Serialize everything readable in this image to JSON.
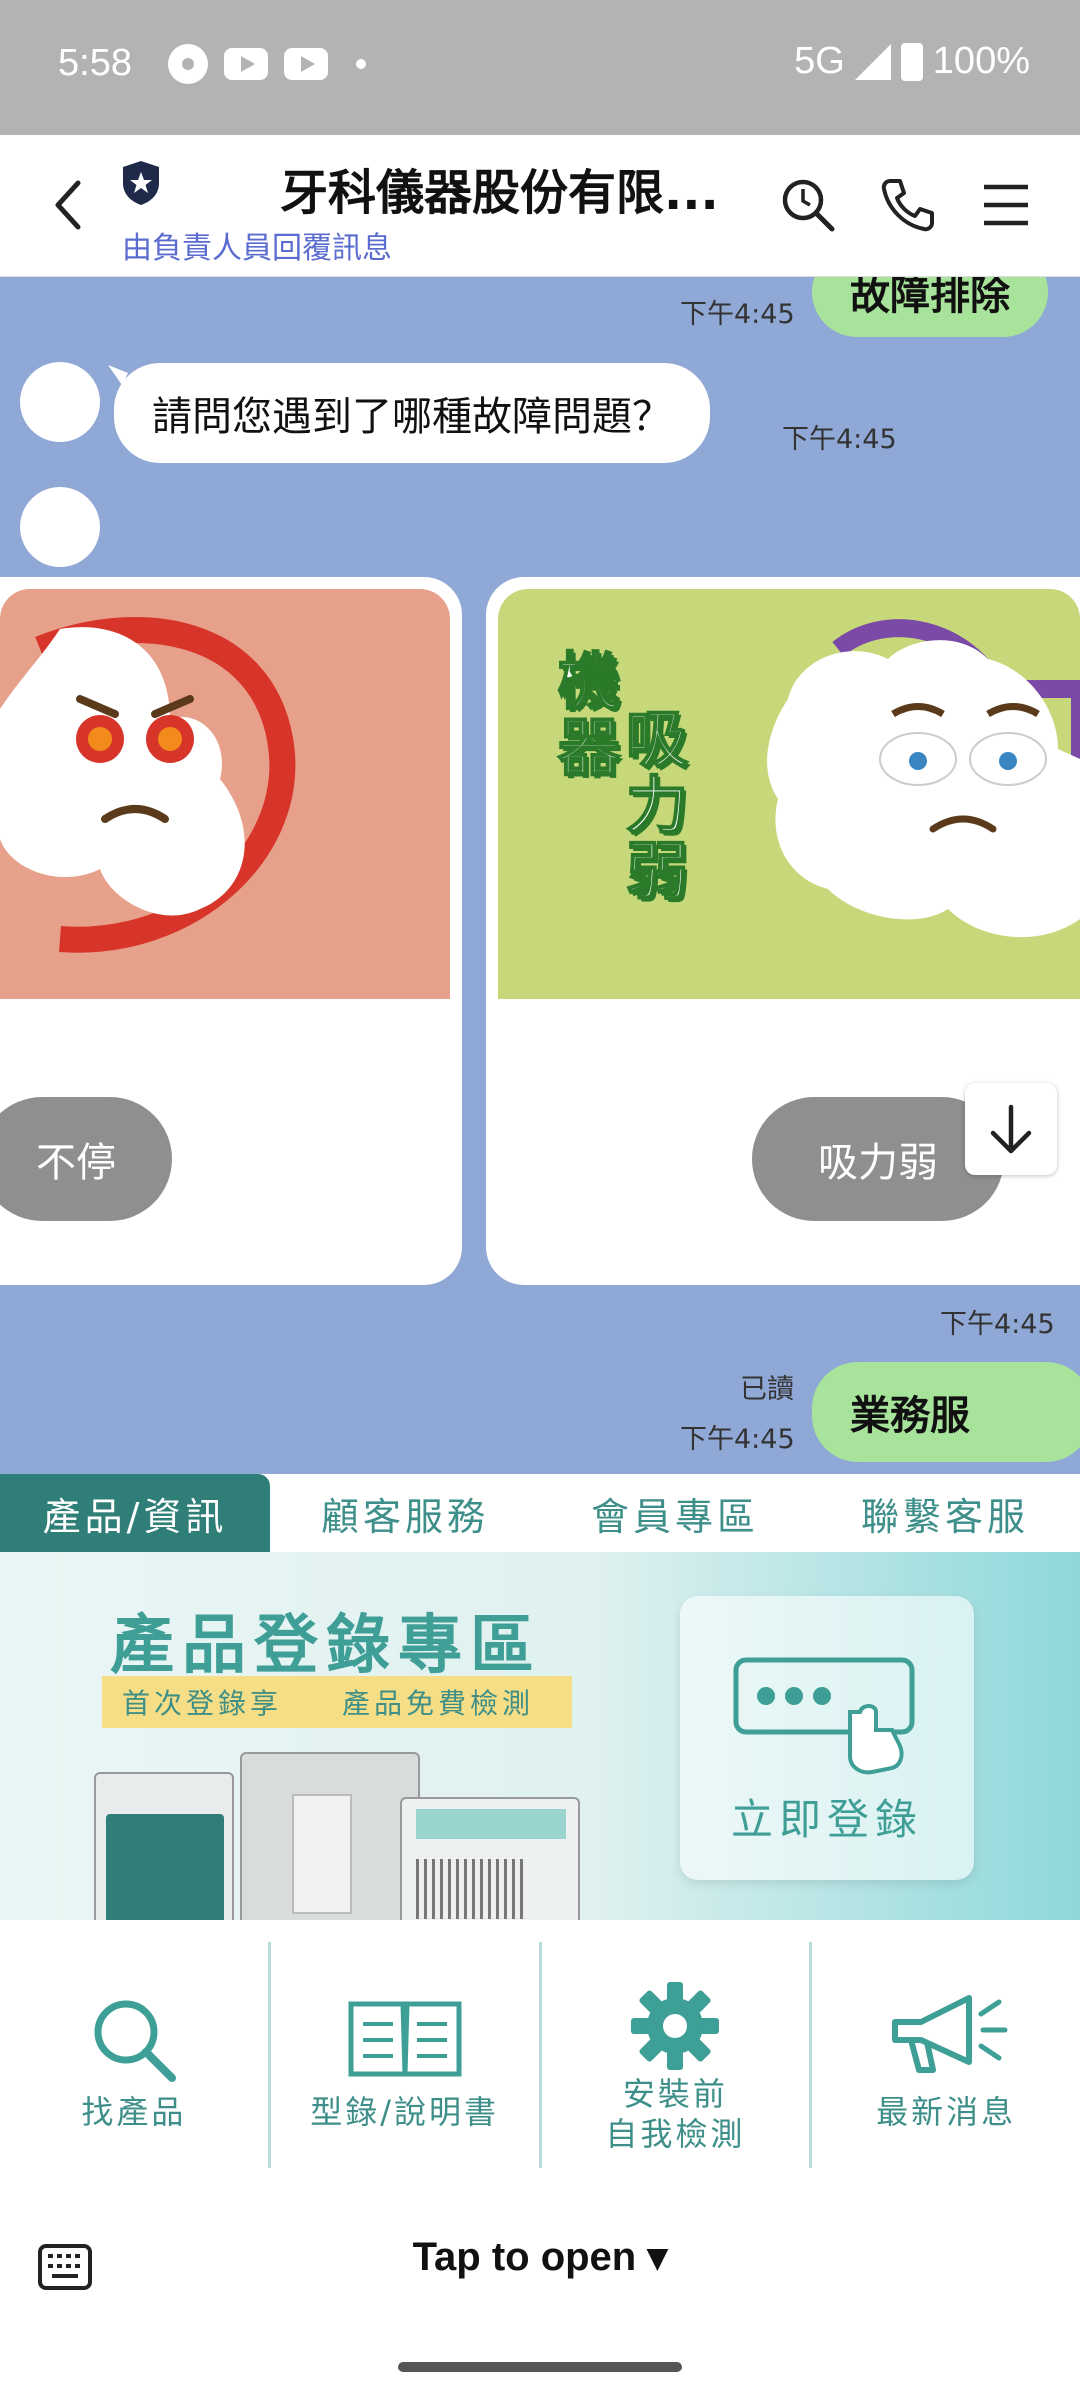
{
  "status_bar": {
    "time": "5:58",
    "network": "5G",
    "battery": "100%"
  },
  "header": {
    "title": "牙科儀器股份有限...",
    "subtitle": "由負責人員回覆訊息"
  },
  "chat": {
    "messages": [
      {
        "side": "out",
        "text": "故障排除",
        "time": "下午4:45"
      },
      {
        "side": "in",
        "text": "請問您遇到了哪種故障問題？",
        "time": "下午4:45"
      }
    ],
    "carousel": {
      "time": "下午4:45",
      "cards": [
        {
          "button_label": "不停",
          "color": "#e7a08a"
        },
        {
          "button_label": "吸力弱",
          "image_text": [
            "機",
            "器",
            "吸",
            "力",
            "弱"
          ],
          "color": "#c7d87a"
        }
      ]
    },
    "last_message": {
      "side": "out",
      "text": "業務服",
      "read_label": "已讀",
      "time": "下午4:45"
    }
  },
  "rich_menu": {
    "tabs": [
      {
        "label": "產品/資訊",
        "active": true
      },
      {
        "label": "顧客服務",
        "active": false
      },
      {
        "label": "會員專區",
        "active": false
      },
      {
        "label": "聯繫客服",
        "active": false
      }
    ],
    "banner": {
      "title": "產品登錄專區",
      "strip_left": "首次登錄享",
      "strip_right": "產品免費檢測",
      "cta": "立即登錄"
    },
    "buttons": [
      {
        "label": "找產品",
        "icon": "search-icon"
      },
      {
        "label": "型錄/說明書",
        "icon": "book-icon"
      },
      {
        "label_line1": "安裝前",
        "label_line2": "自我檢測",
        "icon": "gear-icon"
      },
      {
        "label": "最新消息",
        "icon": "megaphone-icon"
      }
    ]
  },
  "bottom_bar": {
    "tap_to_open": "Tap to open ▾"
  },
  "colors": {
    "chat_bg": "#8fa8d6",
    "bubble_out": "#a8e39b",
    "accent": "#2f7f78"
  }
}
